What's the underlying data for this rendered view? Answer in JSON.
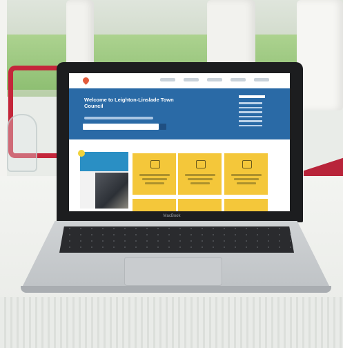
{
  "laptop": {
    "brand": "MacBook"
  },
  "website": {
    "hero_title": "Welcome to Leighton-Linslade Town Council"
  },
  "colors": {
    "hero_blue": "#2a6aa6",
    "tile_yellow": "#f4c73a",
    "chair_red": "#c4263a"
  }
}
